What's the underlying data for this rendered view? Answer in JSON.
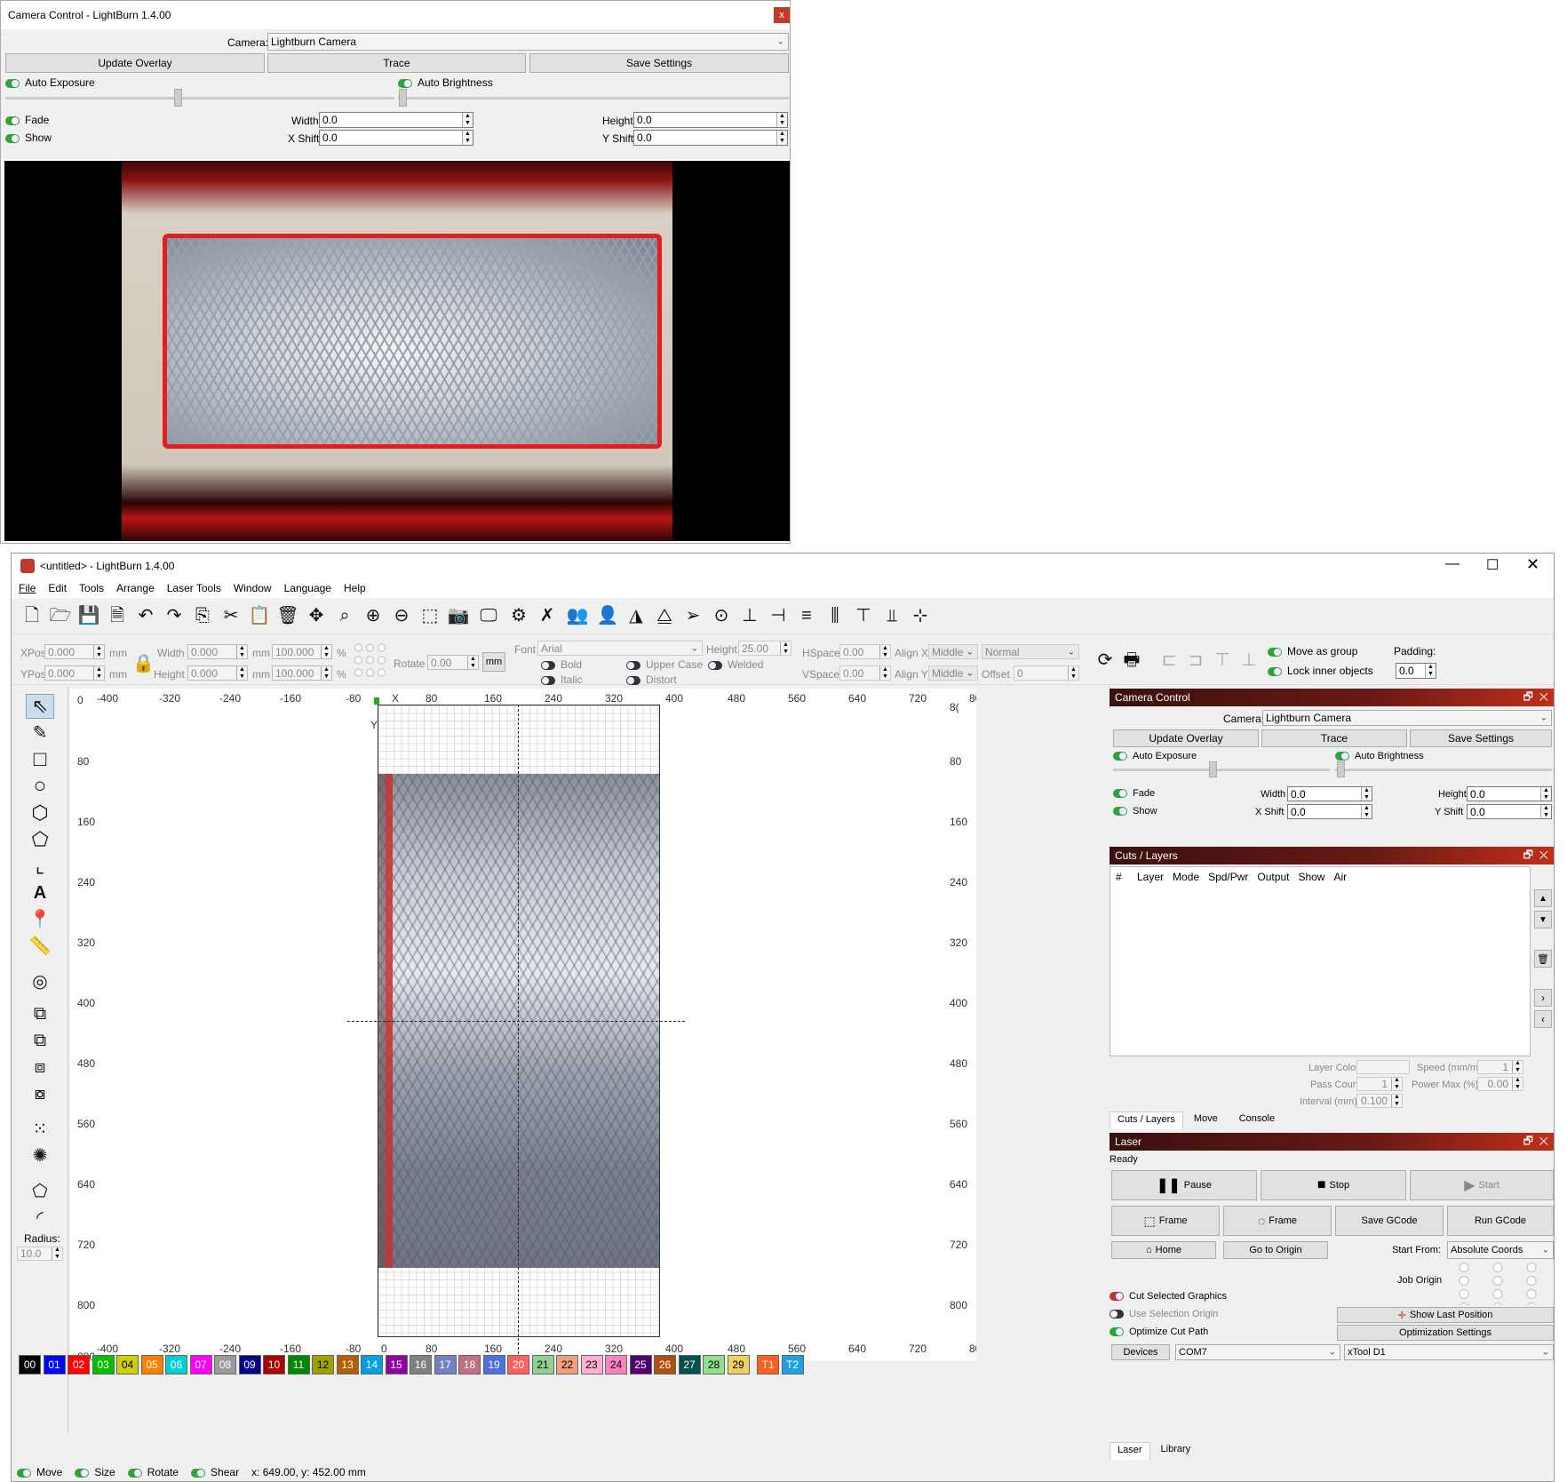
{
  "top_window": {
    "title": "Camera Control - LightBurn 1.4.00",
    "close": "x",
    "camera_label": "Camera:",
    "camera_value": "Lightburn Camera",
    "update_overlay": "Update Overlay",
    "trace": "Trace",
    "save_settings": "Save Settings",
    "auto_exposure": "Auto Exposure",
    "auto_brightness": "Auto Brightness",
    "fade": "Fade",
    "show": "Show",
    "width_label": "Width",
    "width_value": "0.0",
    "height_label": "Height",
    "height_value": "0.0",
    "xshift_label": "X Shift",
    "xshift_value": "0.0",
    "yshift_label": "Y Shift",
    "yshift_value": "0.0"
  },
  "main": {
    "title": "<untitled> - LightBurn 1.4.00",
    "menu": [
      "File",
      "Edit",
      "Tools",
      "Arrange",
      "Laser Tools",
      "Window",
      "Language",
      "Help"
    ],
    "numeric": {
      "xpos_label": "XPos",
      "xpos": "0.000",
      "ypos_label": "YPos",
      "ypos": "0.000",
      "mm": "mm",
      "width_label": "Width",
      "width": "0.000",
      "height_label": "Height",
      "height": "0.000",
      "pct_w": "100.000",
      "pct_h": "100.000",
      "pct": "%",
      "rotate_label": "Rotate",
      "rotate": "0.00",
      "mm_btn": "mm"
    },
    "text": {
      "font_label": "Font",
      "font_value": "Arial",
      "height_label": "Height",
      "height_value": "25.00",
      "hspace_label": "HSpace",
      "hspace": "0.00",
      "vspace_label": "VSpace",
      "vspace": "0.00",
      "alignx_label": "Align X",
      "alignx": "Middle",
      "aligny_label": "Align Y",
      "aligny": "Middle",
      "normal": "Normal",
      "offset_label": "Offset",
      "offset": "0",
      "bold": "Bold",
      "italic": "Italic",
      "upper": "Upper Case",
      "distort": "Distort",
      "welded": "Welded"
    },
    "group": {
      "move_as_group": "Move as group",
      "lock_inner": "Lock inner objects",
      "padding_label": "Padding:",
      "padding": "0.0"
    },
    "ruler_x": [
      "-400",
      "-320",
      "-240",
      "-160",
      "-80",
      "0",
      "80",
      "160",
      "240",
      "320",
      "400",
      "480",
      "560",
      "640",
      "720",
      "800",
      "88"
    ],
    "ruler_y": [
      "0",
      "80",
      "160",
      "240",
      "320",
      "400",
      "480",
      "560",
      "640",
      "720",
      "800",
      "880"
    ],
    "ruler_right_top": "8(",
    "origin_x": "X",
    "origin_y": "Y",
    "radius_label": "Radius:",
    "radius_value": "10.0",
    "palette": [
      {
        "label": "00",
        "color": "#000000"
      },
      {
        "label": "01",
        "color": "#0000ff"
      },
      {
        "label": "02",
        "color": "#ff0000"
      },
      {
        "label": "03",
        "color": "#00c000"
      },
      {
        "label": "04",
        "color": "#d0d000"
      },
      {
        "label": "05",
        "color": "#ff8000"
      },
      {
        "label": "06",
        "color": "#00d0d0"
      },
      {
        "label": "07",
        "color": "#ff00ff"
      },
      {
        "label": "08",
        "color": "#9a9a9a"
      },
      {
        "label": "09",
        "color": "#000088"
      },
      {
        "label": "10",
        "color": "#aa0000"
      },
      {
        "label": "11",
        "color": "#008800"
      },
      {
        "label": "12",
        "color": "#a0a000"
      },
      {
        "label": "13",
        "color": "#b06000"
      },
      {
        "label": "14",
        "color": "#00a0e0"
      },
      {
        "label": "15",
        "color": "#9000a0"
      },
      {
        "label": "16",
        "color": "#808080"
      },
      {
        "label": "17",
        "color": "#7080c0"
      },
      {
        "label": "18",
        "color": "#c07080"
      },
      {
        "label": "19",
        "color": "#5070e0"
      },
      {
        "label": "20",
        "color": "#ff6060"
      },
      {
        "label": "21",
        "color": "#90d090"
      },
      {
        "label": "22",
        "color": "#f0a080"
      },
      {
        "label": "23",
        "color": "#ffb0d0"
      },
      {
        "label": "24",
        "color": "#ff80c0"
      },
      {
        "label": "25",
        "color": "#500070"
      },
      {
        "label": "26",
        "color": "#b05010"
      },
      {
        "label": "27",
        "color": "#005050"
      },
      {
        "label": "28",
        "color": "#90e090"
      },
      {
        "label": "29",
        "color": "#f0d060"
      },
      {
        "label": "T1",
        "color": "#ff6020"
      },
      {
        "label": "T2",
        "color": "#20a0e0"
      }
    ],
    "status": {
      "move": "Move",
      "size": "Size",
      "rotate": "Rotate",
      "shear": "Shear",
      "coords": "x: 649.00, y: 452.00 mm"
    }
  },
  "camera_panel": {
    "title": "Camera Control",
    "camera_label": "Camera:",
    "camera_value": "Lightburn Camera",
    "update_overlay": "Update Overlay",
    "trace": "Trace",
    "save_settings": "Save Settings",
    "auto_exposure": "Auto Exposure",
    "auto_brightness": "Auto Brightness",
    "fade": "Fade",
    "show": "Show",
    "width_label": "Width",
    "width_value": "0.0",
    "height_label": "Height",
    "height_value": "0.0",
    "xshift_label": "X Shift",
    "xshift_value": "0.0",
    "yshift_label": "Y Shift",
    "yshift_value": "0.0"
  },
  "layers_panel": {
    "title": "Cuts / Layers",
    "columns": [
      "#",
      "Layer",
      "Mode",
      "Spd/Pwr",
      "Output",
      "Show",
      "Air"
    ],
    "layer_color": "Layer Color",
    "speed_label": "Speed (mm/m)",
    "speed": "1",
    "pass_label": "Pass Count",
    "pass": "1",
    "power_label": "Power Max (%)",
    "power": "0.00",
    "interval_label": "Interval (mm)",
    "interval": "0.100",
    "tabs": [
      "Cuts / Layers",
      "Move",
      "Console"
    ]
  },
  "laser_panel": {
    "title": "Laser",
    "status": "Ready",
    "pause": "Pause",
    "stop": "Stop",
    "start": "Start",
    "frame1": "Frame",
    "frame2": "Frame",
    "save_gcode": "Save GCode",
    "run_gcode": "Run GCode",
    "home": "Home",
    "go_origin": "Go to Origin",
    "start_from_label": "Start From:",
    "start_from": "Absolute Coords",
    "job_origin": "Job Origin",
    "cut_selected": "Cut Selected Graphics",
    "use_selection": "Use Selection Origin",
    "optimize": "Optimize Cut Path",
    "show_last": "Show Last Position",
    "opt_settings": "Optimization Settings",
    "devices": "Devices",
    "port": "COM7",
    "device": "xTool D1",
    "tabs": [
      "Laser",
      "Library"
    ]
  }
}
